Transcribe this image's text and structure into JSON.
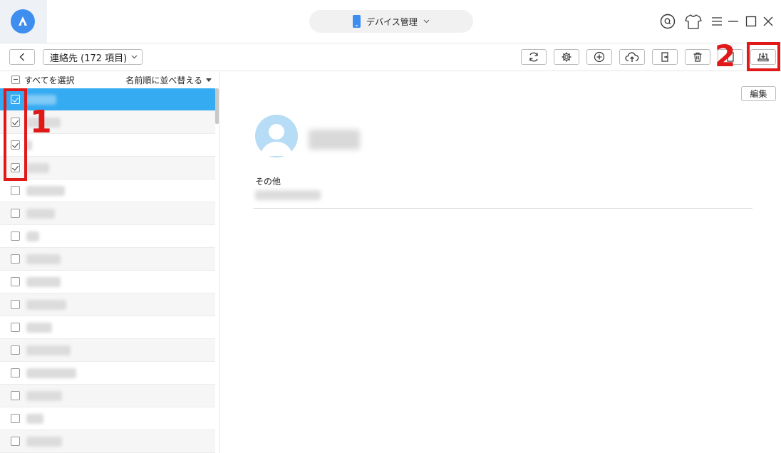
{
  "header": {
    "device_label": "デバイス管理",
    "icons": [
      "app-logo-icon",
      "phone-icon",
      "chevron-down-icon",
      "search-icon",
      "shirt-icon",
      "menu-icon",
      "minimize-icon",
      "maximize-icon",
      "close-icon"
    ]
  },
  "toolbar": {
    "category_label": "連絡先 (172 項目)",
    "actions": [
      "refresh-icon",
      "settings-icon",
      "add-icon",
      "upload-cloud-icon",
      "import-icon",
      "trash-icon",
      "to-device-icon",
      "to-computer-icon"
    ]
  },
  "list": {
    "select_all_label": "すべてを選択",
    "sort_label": "名前順に並べ替える",
    "rows": [
      {
        "checked": true,
        "selected": true
      },
      {
        "checked": true,
        "selected": false
      },
      {
        "checked": true,
        "selected": false
      },
      {
        "checked": true,
        "selected": false
      },
      {
        "checked": false,
        "selected": false
      },
      {
        "checked": false,
        "selected": false
      },
      {
        "checked": false,
        "selected": false
      },
      {
        "checked": false,
        "selected": false
      },
      {
        "checked": false,
        "selected": false
      },
      {
        "checked": false,
        "selected": false
      },
      {
        "checked": false,
        "selected": false
      },
      {
        "checked": false,
        "selected": false
      },
      {
        "checked": false,
        "selected": false
      },
      {
        "checked": false,
        "selected": false
      },
      {
        "checked": false,
        "selected": false
      },
      {
        "checked": false,
        "selected": false
      }
    ]
  },
  "detail": {
    "edit_label": "編集",
    "other_label": "その他"
  },
  "annotations": {
    "step1": "1",
    "step2": "2"
  },
  "colors": {
    "accent": "#35abf2",
    "highlight": "#e01818",
    "logo": "#3e8ef0"
  }
}
